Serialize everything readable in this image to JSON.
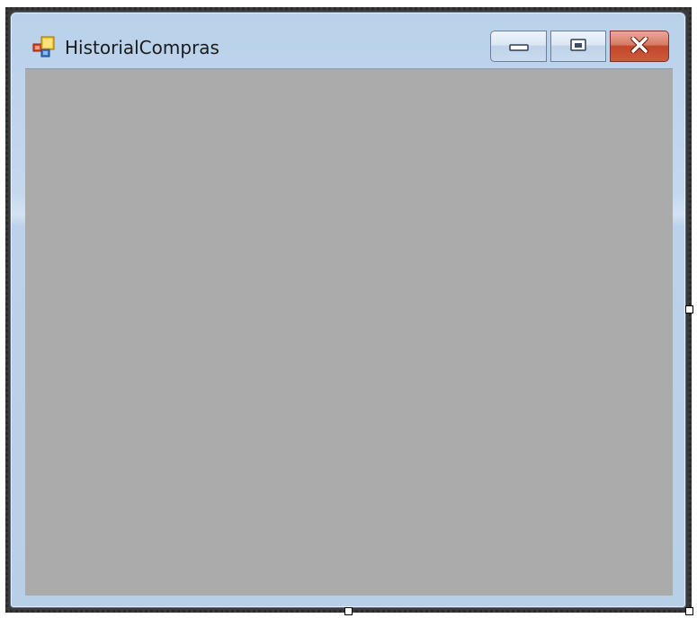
{
  "window": {
    "title": "HistorialCompras",
    "icon": "form-icon",
    "client_background": "#ababab"
  },
  "caption_buttons": {
    "minimize": "minimize-icon",
    "maximize": "maximize-icon",
    "close": "close-icon",
    "close_color": "#c1462a"
  },
  "designer": {
    "selection_handles": [
      "right",
      "bottom",
      "bottom-right"
    ]
  }
}
